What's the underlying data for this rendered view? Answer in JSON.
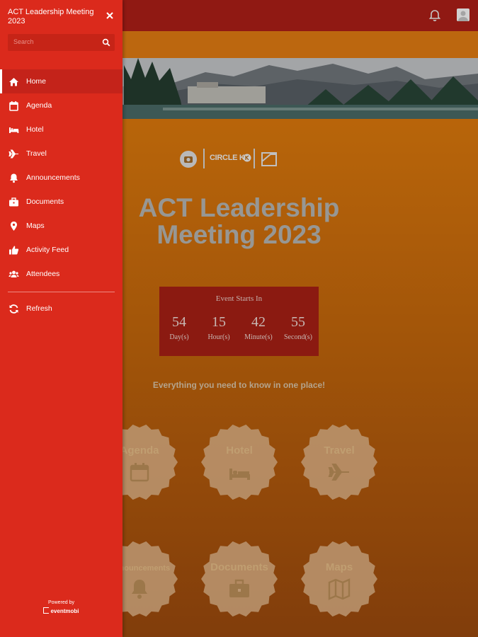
{
  "drawer": {
    "title": "ACT Leadership Meeting 2023",
    "search_placeholder": "Search",
    "items": [
      {
        "label": "Home",
        "icon": "home-icon"
      },
      {
        "label": "Agenda",
        "icon": "calendar-icon"
      },
      {
        "label": "Hotel",
        "icon": "bed-icon"
      },
      {
        "label": "Travel",
        "icon": "plane-icon"
      },
      {
        "label": "Announcements",
        "icon": "bell-icon"
      },
      {
        "label": "Documents",
        "icon": "briefcase-icon"
      },
      {
        "label": "Maps",
        "icon": "map-marker-icon"
      },
      {
        "label": "Activity Feed",
        "icon": "thumbs-up-icon"
      },
      {
        "label": "Attendees",
        "icon": "users-icon"
      },
      {
        "label": "Refresh",
        "icon": "refresh-icon"
      }
    ],
    "active_item": "Home",
    "powered_by": "Powered by",
    "brand": "eventmobi"
  },
  "main": {
    "logo_text": "CIRCLE K",
    "event_title": "ACT Leadership Meeting 2023",
    "countdown": {
      "title": "Event Starts In",
      "units": [
        {
          "value": "54",
          "label": "Day(s)"
        },
        {
          "value": "15",
          "label": "Hour(s)"
        },
        {
          "value": "42",
          "label": "Minute(s)"
        },
        {
          "value": "55",
          "label": "Second(s)"
        }
      ]
    },
    "tagline": "Everything you need to know in one place!",
    "tiles": [
      {
        "label": "Agenda",
        "icon": "calendar-icon"
      },
      {
        "label": "Hotel",
        "icon": "bed-icon"
      },
      {
        "label": "Travel",
        "icon": "plane-icon"
      },
      {
        "label": "Announcements",
        "icon": "bell-icon"
      },
      {
        "label": "Documents",
        "icon": "briefcase-icon"
      },
      {
        "label": "Maps",
        "icon": "map-icon"
      }
    ]
  },
  "colors": {
    "drawer_bg": "#db2a1c",
    "topbar_bg": "#931a14",
    "countdown_bg": "#8e1b12",
    "page_bg": "#c8700c"
  }
}
